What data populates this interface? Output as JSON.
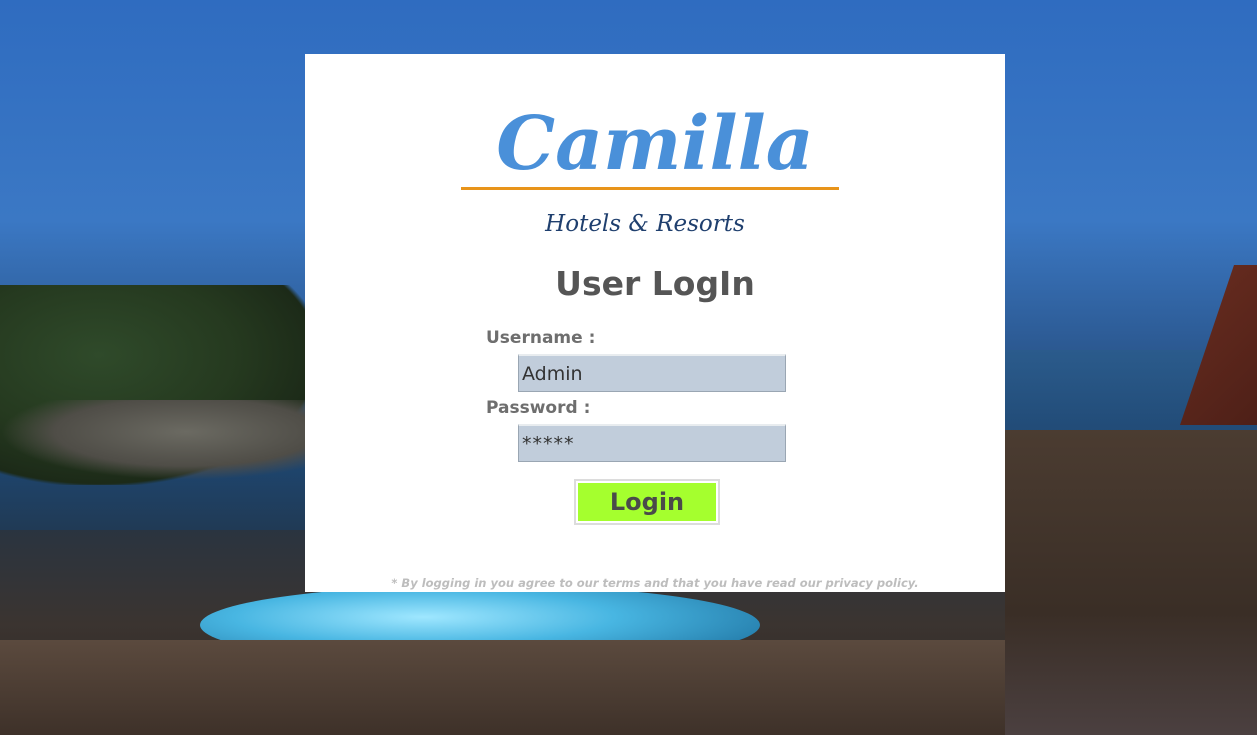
{
  "brand": {
    "name": "Camilla",
    "tagline": "Hotels & Resorts",
    "primary_color": "#4a90d9",
    "underline_color": "#e8941a",
    "tagline_color": "#1f3f6e"
  },
  "login": {
    "title": "User LogIn",
    "username_label": "Username :",
    "username_value": "Admin",
    "password_label": "Password :",
    "password_value": "*****",
    "button_label": "Login",
    "button_color": "#a5ff2e",
    "terms_text": "* By logging in you agree to our terms and that you have read our privacy policy."
  },
  "background": {
    "scene": "resort-background"
  }
}
